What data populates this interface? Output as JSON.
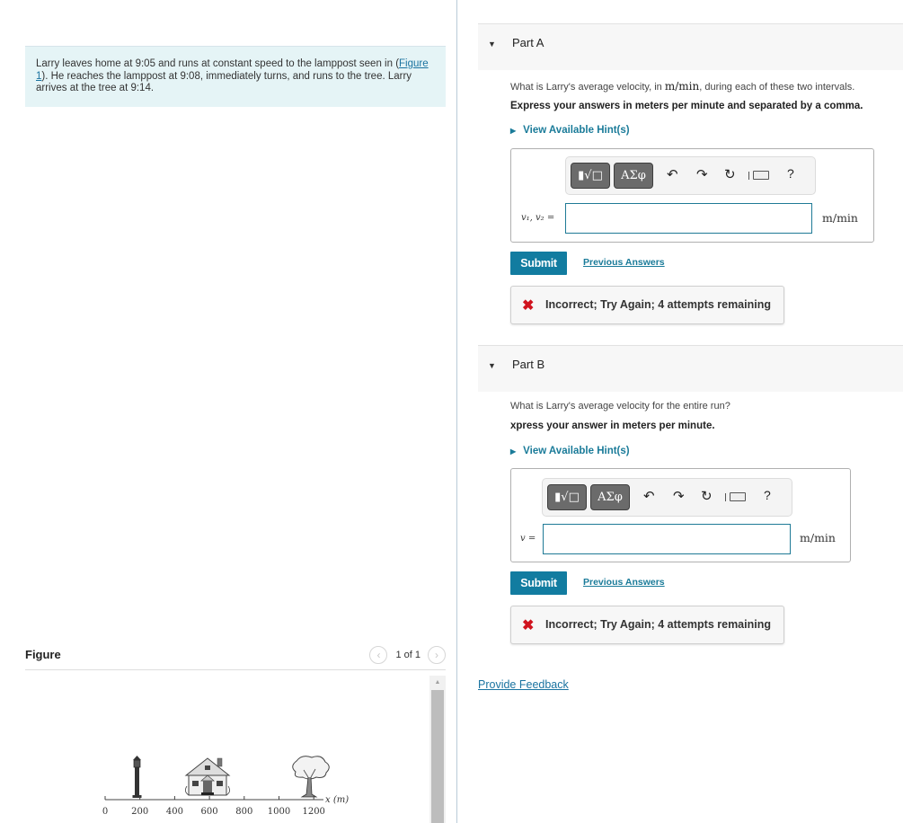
{
  "problem": {
    "text_before_link": "Larry leaves home at 9:05 and runs at constant speed to the lamppost seen in (",
    "figure_link": "Figure 1",
    "text_after_link": "). He reaches the lamppost at 9:08, immediately turns, and runs to the tree. Larry arrives at the tree at 9:14."
  },
  "figure": {
    "title": "Figure",
    "prev_icon": "chevron-left-icon",
    "next_icon": "chevron-right-icon",
    "page_indicator": "1 of 1",
    "axis_label": "x (m)",
    "ticks": [
      "0",
      "200",
      "400",
      "600",
      "800",
      "1000",
      "1200"
    ],
    "objects": [
      {
        "name": "lamppost",
        "position_m": 200
      },
      {
        "name": "house",
        "position_m": 600
      },
      {
        "name": "tree",
        "position_m": 1200
      }
    ]
  },
  "parts": [
    {
      "title": "Part A",
      "question_before": "What is Larry's average velocity, in ",
      "question_unit": "m/min",
      "question_after": ", during each of these two intervals.",
      "instruction": "Express your answers in meters per minute and separated by a comma.",
      "hint_label": "View Available Hint(s)",
      "toolbar": {
        "template_button": "▮√□",
        "greek_button": "ΑΣφ",
        "undo_icon": "undo-icon",
        "redo_icon": "redo-icon",
        "reset_icon": "reset-icon",
        "keyboard_icon": "keyboard-icon",
        "help_label": "?"
      },
      "variable_label": "v₁, v₂ =",
      "input_value": "",
      "unit": "m/min",
      "submit_label": "Submit",
      "previous_answers_label": "Previous Answers",
      "feedback_message": "Incorrect; Try Again; 4 attempts remaining"
    },
    {
      "title": "Part B",
      "question_before": "What is Larry's average velocity for the entire run?",
      "question_unit": "",
      "question_after": "",
      "instruction": "xpress your answer in meters per minute.",
      "hint_label": "View Available Hint(s)",
      "toolbar": {
        "template_button": "▮√□",
        "greek_button": "ΑΣφ",
        "undo_icon": "undo-icon",
        "redo_icon": "redo-icon",
        "reset_icon": "reset-icon",
        "keyboard_icon": "keyboard-icon",
        "help_label": "?"
      },
      "variable_label": "v =",
      "input_value": "",
      "unit": "m/min",
      "submit_label": "Submit",
      "previous_answers_label": "Previous Answers",
      "feedback_message": "Incorrect; Try Again; 4 attempts remaining"
    }
  ],
  "provide_feedback_label": "Provide Feedback",
  "colors": {
    "accent": "#127ca0",
    "link": "#1a7b99",
    "error": "#d0131e",
    "problem_bg": "#e5f4f6"
  }
}
